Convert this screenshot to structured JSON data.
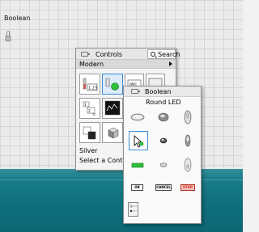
{
  "front_panel": {
    "boolean_label": "Boolean"
  },
  "controls_palette": {
    "title": "Controls",
    "search_label": "Search",
    "category": "Modern",
    "silver_label": "Silver",
    "select_control_label": "Select a Control..."
  },
  "boolean_palette": {
    "title": "Boolean",
    "hover_label": "Round LED",
    "buttons": {
      "ok": "OK",
      "cancel": "CANCEL",
      "stop": "STOP"
    }
  },
  "colors": {
    "led_green": "#2fbf3a",
    "stop_red": "#e23a2a",
    "selection_blue": "#3a8cd8",
    "teal": "#10707d"
  }
}
